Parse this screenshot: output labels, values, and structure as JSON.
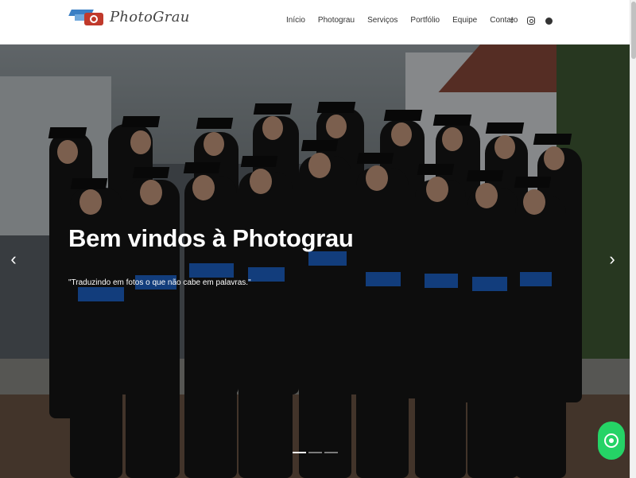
{
  "brand": {
    "logo_text": "PhotoGrau"
  },
  "nav": {
    "items": [
      "Início",
      "Photograu",
      "Serviços",
      "Portfólio",
      "Equipe",
      "Contato"
    ]
  },
  "social": {
    "icons": [
      "facebook-icon",
      "instagram-icon",
      "whatsapp-icon"
    ],
    "facebook_glyph": "f"
  },
  "hero": {
    "title": "Bem vindos à Photograu",
    "subtitle": "\"Traduzindo em fotos o que não cabe em palavras.\"",
    "prev_glyph": "‹",
    "next_glyph": "›",
    "slides": 3,
    "active_slide": 1
  },
  "colors": {
    "accent_blue": "#1e63c9",
    "whatsapp_green": "#25d366",
    "gown_black": "#151515"
  }
}
